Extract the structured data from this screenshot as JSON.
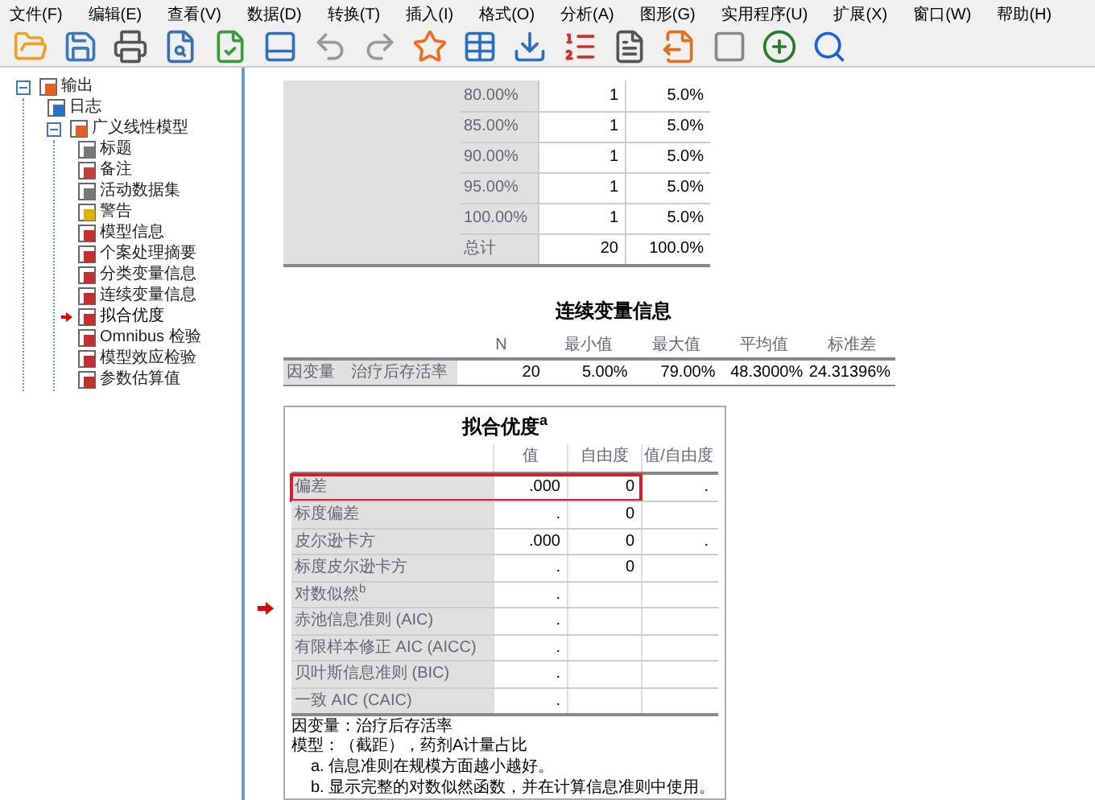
{
  "menu": [
    "文件(F)",
    "编辑(E)",
    "查看(V)",
    "数据(D)",
    "转换(T)",
    "插入(I)",
    "格式(O)",
    "分析(A)",
    "图形(G)",
    "实用程序(U)",
    "扩展(X)",
    "窗口(W)",
    "帮助(H)"
  ],
  "tree": [
    {
      "label": "输出",
      "kind": "output",
      "expanded": true,
      "selected": false,
      "children": [
        {
          "label": "日志",
          "kind": "log",
          "selected": false
        },
        {
          "label": "广义线性模型",
          "kind": "output",
          "expanded": true,
          "selected": false,
          "children": [
            {
              "label": "标题",
              "kind": "title",
              "selected": false
            },
            {
              "label": "备注",
              "kind": "note",
              "selected": false
            },
            {
              "label": "活动数据集",
              "kind": "dataset",
              "selected": false
            },
            {
              "label": "警告",
              "kind": "warning",
              "selected": false
            },
            {
              "label": "模型信息",
              "kind": "table",
              "selected": false
            },
            {
              "label": "个案处理摘要",
              "kind": "table",
              "selected": false
            },
            {
              "label": "分类变量信息",
              "kind": "table",
              "selected": false
            },
            {
              "label": "连续变量信息",
              "kind": "table",
              "selected": false
            },
            {
              "label": "拟合优度",
              "kind": "table",
              "selected": true
            },
            {
              "label": "Omnibus 检验",
              "kind": "table",
              "selected": false
            },
            {
              "label": "模型效应检验",
              "kind": "table",
              "selected": false
            },
            {
              "label": "参数估算值",
              "kind": "table",
              "selected": false
            }
          ]
        }
      ]
    }
  ],
  "frequency_table": {
    "rows": [
      {
        "label": "80.00%",
        "n": "1",
        "percent": "5.0%"
      },
      {
        "label": "85.00%",
        "n": "1",
        "percent": "5.0%"
      },
      {
        "label": "90.00%",
        "n": "1",
        "percent": "5.0%"
      },
      {
        "label": "95.00%",
        "n": "1",
        "percent": "5.0%"
      },
      {
        "label": "100.00%",
        "n": "1",
        "percent": "5.0%"
      },
      {
        "label": "总计",
        "n": "20",
        "percent": "100.0%"
      }
    ]
  },
  "continuous_table": {
    "title": "连续变量信息",
    "columns": [
      "N",
      "最小值",
      "最大值",
      "平均值",
      "标准差"
    ],
    "rows": [
      {
        "group": "因变量",
        "label": "治疗后存活率",
        "cells": [
          "20",
          "5.00%",
          "79.00%",
          "48.3000%",
          "24.31396%"
        ]
      }
    ]
  },
  "fit_table": {
    "title": "拟合优度$^{a}$",
    "columns": [
      "值",
      "自由度",
      "值/自由度"
    ],
    "rows": [
      {
        "label": "偏差",
        "cells": [
          ".000",
          "0",
          "."
        ],
        "highlighted": true
      },
      {
        "label": "标度偏差",
        "cells": [
          ".",
          "0",
          null
        ],
        "highlighted": false
      },
      {
        "label": "皮尔逊卡方",
        "cells": [
          ".000",
          "0",
          "."
        ],
        "highlighted": false
      },
      {
        "label": "标度皮尔逊卡方",
        "cells": [
          ".",
          "0",
          null
        ],
        "highlighted": false
      },
      {
        "label": "对数似然$^{b}$",
        "cells": [
          ".",
          null,
          null
        ],
        "highlighted": false
      },
      {
        "label": "赤池信息准则 (AIC)",
        "cells": [
          ".",
          null,
          null
        ],
        "highlighted": false
      },
      {
        "label": "有限样本修正 AIC (AICC)",
        "cells": [
          ".",
          null,
          null
        ],
        "highlighted": false
      },
      {
        "label": "贝叶斯信息准则 (BIC)",
        "cells": [
          ".",
          null,
          null
        ],
        "highlighted": false
      },
      {
        "label": "一致 AIC (CAIC)",
        "cells": [
          ".",
          null,
          null
        ],
        "highlighted": false
      }
    ],
    "notes": [
      "因变量：治疗后存活率",
      "模型：（截距），药剂A计量占比"
    ],
    "footnotes": [
      "a. 信息准则在规模方面越小越好。",
      "b. 显示完整的对数似然函数，并在计算信息准则中使用。"
    ]
  }
}
